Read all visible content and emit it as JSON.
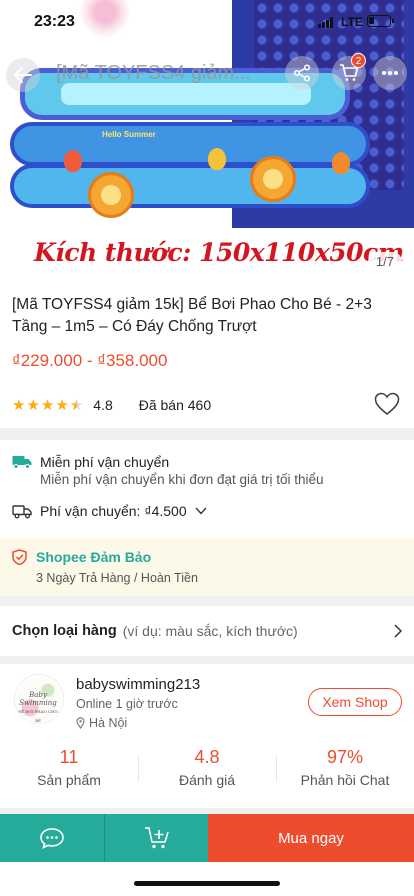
{
  "status_bar": {
    "time": "23:23",
    "network": "LTE"
  },
  "header": {
    "search_text": "[Mã TOYFSS4 giảm...",
    "cart_badge": "2",
    "icons": [
      "back-arrow-icon",
      "share-icon",
      "cart-icon",
      "more-icon"
    ]
  },
  "gallery": {
    "size_text": "Kích thước: 150x110x50cm",
    "counter": "1/7",
    "pool_print": "Hello Summer"
  },
  "product": {
    "title": "[Mã TOYFSS4 giảm 15k] Bể Bơi Phao Cho Bé - 2+3 Tầng – 1m5 – Có Đáy Chống Trượt",
    "price_range": "₫229.000 - ₫358.000",
    "rating": 4.8,
    "rating_text": "4.8",
    "sold_text": "Đã bán 460"
  },
  "shipping": {
    "free_title": "Miễn phí vận chuyển",
    "free_sub": "Miễn phí vận chuyển khi đơn đạt giá trị tối thiểu",
    "fee_label": "Phí vận chuyển:",
    "fee_value": "₫4.500"
  },
  "guarantee": {
    "title": "Shopee Đảm Bảo",
    "sub": "3 Ngày Trả Hàng / Hoàn Tiền"
  },
  "variant": {
    "label": "Chọn loại hàng",
    "hint": "(ví dụ: màu sắc, kích thước)"
  },
  "shop": {
    "avatar_text_1": "Baby Swimming",
    "avatar_text_2": "BỂ BƠI PHAO CHO BÉ",
    "name": "babyswimming213",
    "online": "Online 1 giờ trước",
    "location": "Hà Nội",
    "view_shop": "Xem Shop",
    "stats": [
      {
        "value": "11",
        "label": "Sản phẩm"
      },
      {
        "value": "4.8",
        "label": "Đánh giá"
      },
      {
        "value": "97%",
        "label": "Phản hồi Chat"
      }
    ]
  },
  "bottom_bar": {
    "buy_now": "Mua ngay"
  },
  "colors": {
    "accent": "#ee4d2d",
    "teal": "#26aa99",
    "star": "#ffaa0f",
    "guarantee_bg": "#fdf9e8",
    "banner_red": "#d4141e"
  }
}
